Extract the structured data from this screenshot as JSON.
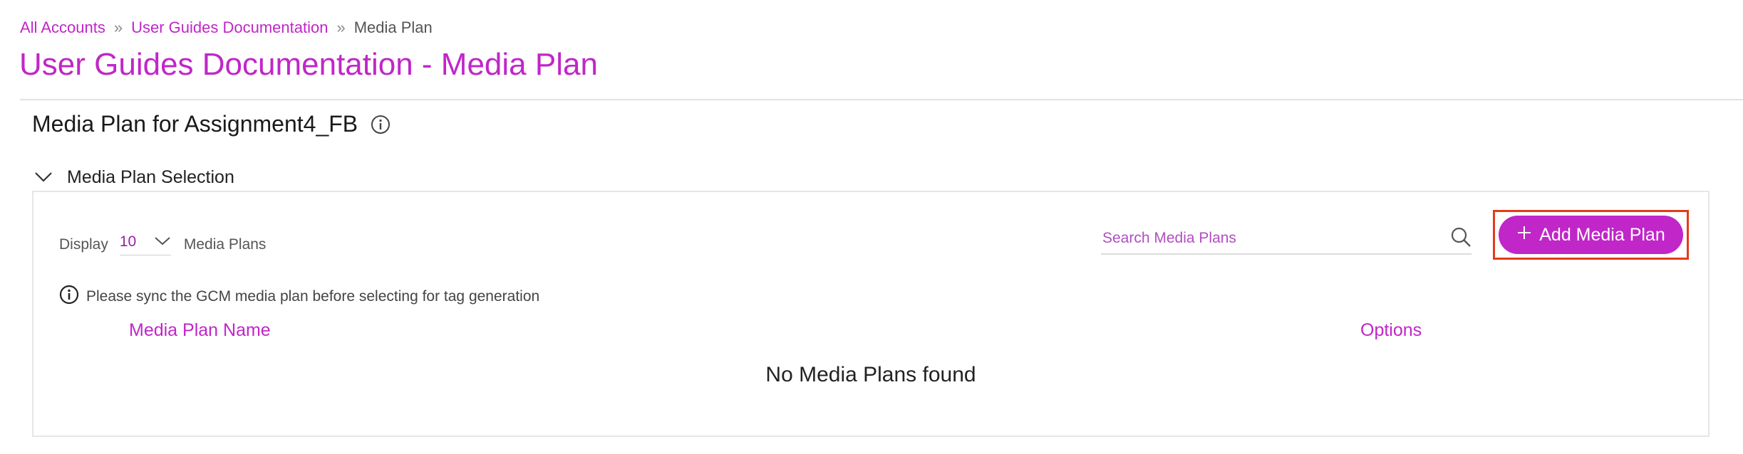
{
  "breadcrumb": {
    "items": [
      {
        "label": "All Accounts"
      },
      {
        "label": "User Guides Documentation"
      }
    ],
    "current": "Media Plan",
    "separator": "»"
  },
  "page": {
    "title": "User Guides Documentation - Media Plan",
    "accent_color": "#c026c8"
  },
  "section": {
    "title": "Media Plan for Assignment4_FB",
    "info_icon": "info-circle-icon"
  },
  "selection_panel": {
    "label": "Media Plan Selection",
    "toggle_icon": "chevron-down-icon",
    "display": {
      "prefix": "Display",
      "value": "10",
      "suffix": "Media Plans"
    },
    "search": {
      "placeholder": "Search Media Plans",
      "value": "",
      "icon": "search-icon"
    },
    "add_button": {
      "label": "Add Media Plan",
      "icon": "plus-icon",
      "highlight_color": "#e53a1a"
    },
    "notice": "Please sync the GCM media plan before selecting for tag generation",
    "columns": [
      "Media Plan Name",
      "Options"
    ],
    "empty_message": "No Media Plans found"
  }
}
